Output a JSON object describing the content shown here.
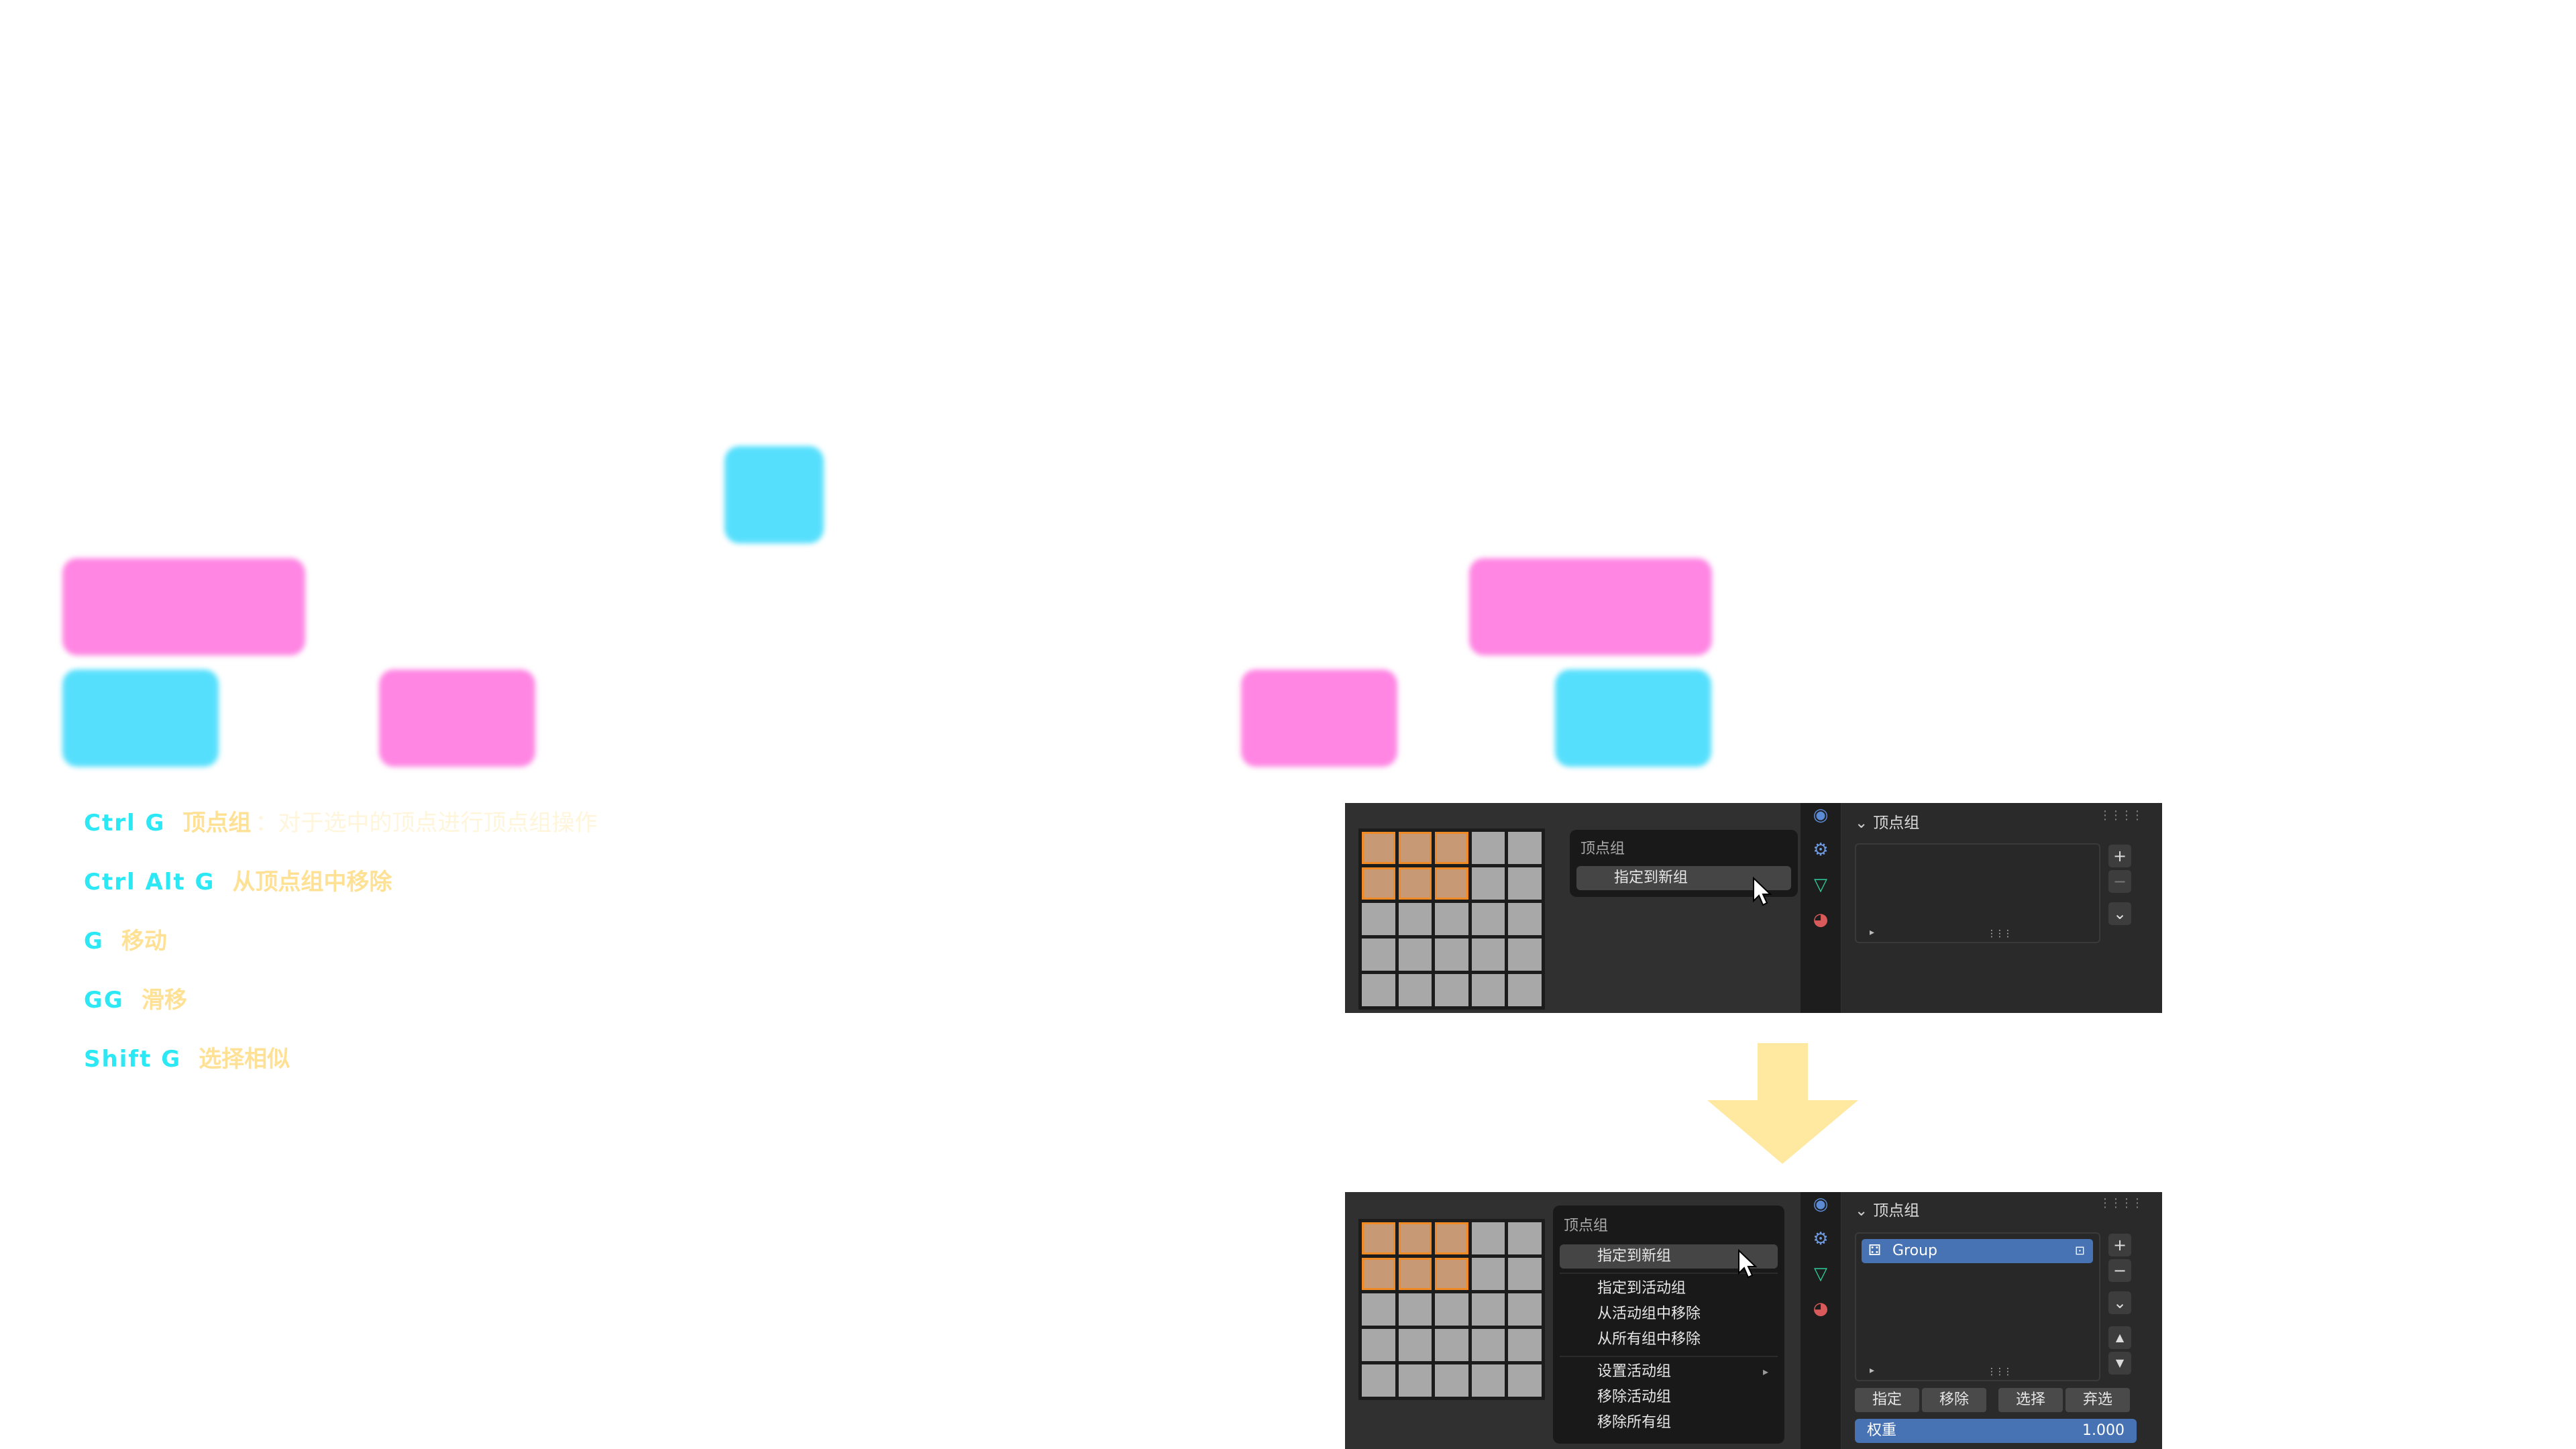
{
  "hotkeys": [
    {
      "key": "Ctrl G",
      "desc": "顶点组",
      "note": "：对于选中的顶点进行顶点组操作"
    },
    {
      "key": "Ctrl Alt G",
      "desc": "从顶点组中移除",
      "note": ""
    },
    {
      "key": "G",
      "desc": "移动",
      "note": ""
    },
    {
      "key": "GG",
      "desc": "滑移",
      "note": ""
    },
    {
      "key": "Shift G",
      "desc": "选择相似",
      "note": ""
    }
  ],
  "top_panel": {
    "menu_title": "顶点组",
    "menu_item": "指定到新组",
    "props_header": "顶点组"
  },
  "bottom_panel": {
    "menu_title": "顶点组",
    "menu_items": [
      "指定到新组",
      "指定到活动组",
      "从活动组中移除",
      "从所有组中移除",
      "设置活动组",
      "移除活动组",
      "移除所有组"
    ],
    "props_header": "顶点组",
    "group_name": "Group",
    "buttons": [
      "指定",
      "移除",
      "选择",
      "弃选"
    ],
    "weight_label": "权重",
    "weight_value": "1.000"
  },
  "colors": {
    "key": "#2ce8f5",
    "desc": "#ffe196",
    "cyan_block": "#56dffc",
    "pink_block": "#ff86e3",
    "arrow": "#ffe9a0",
    "accent": "#4772b3"
  },
  "icons": {
    "submenu": "▸",
    "plus": "+",
    "minus": "−",
    "chevron": "⌄",
    "up": "▲",
    "down": "▼",
    "play": "▸"
  }
}
